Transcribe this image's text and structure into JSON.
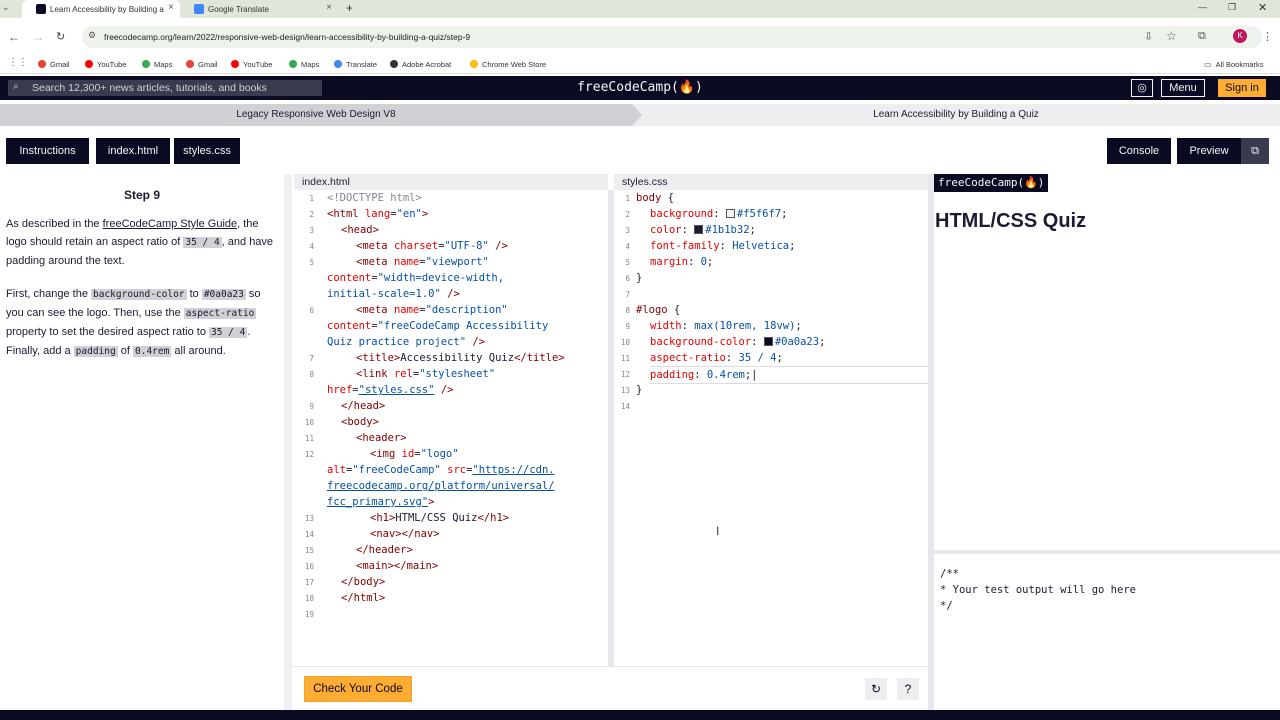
{
  "browser": {
    "tabs": [
      {
        "title": "Learn Accessibility by Building a"
      },
      {
        "title": "Google Translate"
      }
    ],
    "new_tab": "+",
    "url": "freecodecamp.org/learn/2022/responsive-web-design/learn-accessibility-by-building-a-quiz/step-9",
    "profile_initial": "K",
    "bookmarks": [
      {
        "label": "Gmail",
        "icon": "gmail-icon",
        "color": "#ea4335"
      },
      {
        "label": "YouTube",
        "icon": "youtube-icon",
        "color": "#ff0000"
      },
      {
        "label": "Maps",
        "icon": "maps-icon",
        "color": "#34a853"
      },
      {
        "label": "Gmail",
        "icon": "gmail-icon",
        "color": "#ea4335"
      },
      {
        "label": "YouTube",
        "icon": "youtube-icon",
        "color": "#ff0000"
      },
      {
        "label": "Maps",
        "icon": "maps-icon",
        "color": "#34a853"
      },
      {
        "label": "Translate",
        "icon": "translate-icon",
        "color": "#4285f4"
      },
      {
        "label": "Adobe Acrobat",
        "icon": "acrobat-icon",
        "color": "#333333"
      },
      {
        "label": "Chrome Web Store",
        "icon": "webstore-icon",
        "color": "#fbbc04"
      }
    ],
    "all_bookmarks": "All Bookmarks"
  },
  "nav": {
    "search_placeholder": "Search 12,300+ news articles, tutorials, and books",
    "brand": "freeCodeCamp(🔥)",
    "menu": "Menu",
    "signin": "Sign in"
  },
  "breadcrumb": {
    "left": "Legacy Responsive Web Design V8",
    "right": "Learn Accessibility by Building a Quiz"
  },
  "toolbar": {
    "instructions": "Instructions",
    "index_html": "index.html",
    "styles_css": "styles.css",
    "console": "Console",
    "preview": "Preview"
  },
  "instructions": {
    "step": "Step 9",
    "p1_a": "As described in the ",
    "p1_link": "freeCodeCamp Style Guide",
    "p1_b": ", the logo should retain an aspect ratio of ",
    "p1_code": "35 / 4",
    "p1_c": ", and have padding around the text.",
    "p2_a": "First, change the ",
    "p2_code1": "background-color",
    "p2_b": " to ",
    "p2_code2": "#0a0a23",
    "p2_c": " so you can see the logo. Then, use the ",
    "p2_code3": "aspect-ratio",
    "p2_d": " property to set the desired aspect ratio to ",
    "p2_code4": "35 / 4",
    "p2_e": ". Finally, add a ",
    "p2_code5": "padding",
    "p2_f": " of ",
    "p2_code6": "0.4rem",
    "p2_g": " all around."
  },
  "html_editor": {
    "title": "index.html",
    "line_numbers": [
      "1",
      "2",
      "3",
      "4",
      "5",
      "6",
      "7",
      "8",
      "9",
      "10",
      "11",
      "12",
      "13",
      "14",
      "15",
      "16",
      "17",
      "18",
      "19"
    ]
  },
  "css_editor": {
    "title": "styles.css",
    "line_numbers": [
      "1",
      "2",
      "3",
      "4",
      "5",
      "6",
      "7",
      "8",
      "9",
      "10",
      "11",
      "12",
      "13",
      "14"
    ]
  },
  "preview": {
    "logo": "freeCodeCamp(🔥)",
    "heading": "HTML/CSS Quiz"
  },
  "console": {
    "line1": "/**",
    "line2": "* Your test output will go here",
    "line3": "*/"
  },
  "bottom": {
    "check": "Check Your Code"
  },
  "colors": {
    "navy": "#0a0a23",
    "accent": "#feac32",
    "bg": "#f5f6f7",
    "text": "#1b1b32"
  }
}
